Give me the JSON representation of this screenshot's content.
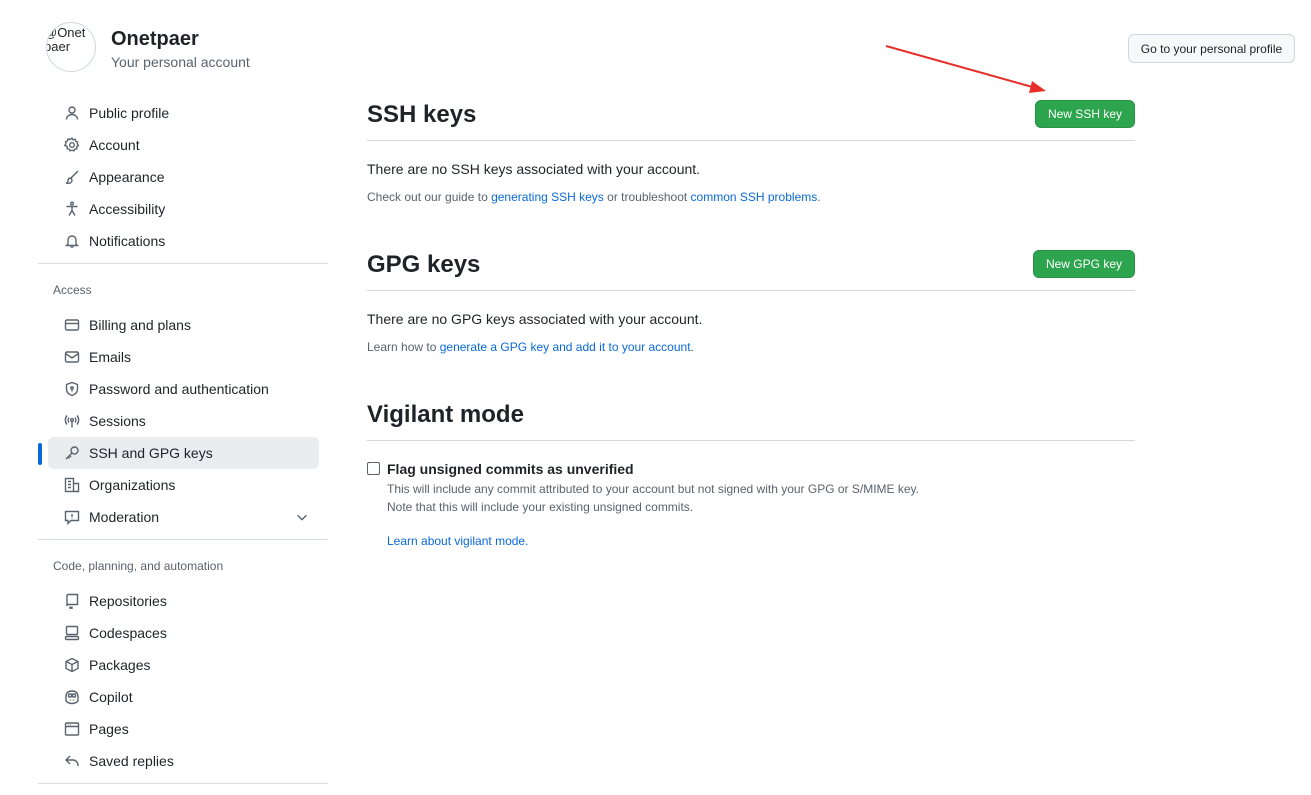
{
  "account": {
    "avatar_alt_line1": "@Onet",
    "avatar_alt_line2": "paer",
    "name": "Onetpaer",
    "subtitle": "Your personal account",
    "go_profile_label": "Go to your personal profile"
  },
  "sidebar": {
    "top_items": [
      {
        "label": "Public profile",
        "icon": "person-icon"
      },
      {
        "label": "Account",
        "icon": "gear-icon"
      },
      {
        "label": "Appearance",
        "icon": "paintbrush-icon"
      },
      {
        "label": "Accessibility",
        "icon": "accessibility-icon"
      },
      {
        "label": "Notifications",
        "icon": "bell-icon"
      }
    ],
    "access_heading": "Access",
    "access_items": [
      {
        "label": "Billing and plans",
        "icon": "credit-card-icon"
      },
      {
        "label": "Emails",
        "icon": "mail-icon"
      },
      {
        "label": "Password and authentication",
        "icon": "shield-lock-icon"
      },
      {
        "label": "Sessions",
        "icon": "broadcast-icon"
      },
      {
        "label": "SSH and GPG keys",
        "icon": "key-icon",
        "active": true
      },
      {
        "label": "Organizations",
        "icon": "organization-icon"
      },
      {
        "label": "Moderation",
        "icon": "report-icon",
        "expandable": true
      }
    ],
    "code_heading": "Code, planning, and automation",
    "code_items": [
      {
        "label": "Repositories",
        "icon": "repo-icon"
      },
      {
        "label": "Codespaces",
        "icon": "codespaces-icon"
      },
      {
        "label": "Packages",
        "icon": "package-icon"
      },
      {
        "label": "Copilot",
        "icon": "copilot-icon"
      },
      {
        "label": "Pages",
        "icon": "browser-icon"
      },
      {
        "label": "Saved replies",
        "icon": "reply-icon"
      }
    ]
  },
  "ssh": {
    "title": "SSH keys",
    "button": "New SSH key",
    "empty_msg": "There are no SSH keys associated with your account.",
    "guide_prefix": "Check out our guide to ",
    "guide_link1": "generating SSH keys",
    "guide_middle": " or troubleshoot ",
    "guide_link2": "common SSH problems",
    "guide_suffix": "."
  },
  "gpg": {
    "title": "GPG keys",
    "button": "New GPG key",
    "empty_msg": "There are no GPG keys associated with your account.",
    "learn_prefix": "Learn how to ",
    "learn_link": "generate a GPG key and add it to your account",
    "learn_suffix": "."
  },
  "vigilant": {
    "title": "Vigilant mode",
    "checkbox_label": "Flag unsigned commits as unverified",
    "checked": false,
    "note_line1": "This will include any commit attributed to your account but not signed with your GPG or S/MIME key.",
    "note_line2": "Note that this will include your existing unsigned commits.",
    "learn_link": "Learn about vigilant mode."
  },
  "colors": {
    "accent": "#0969da",
    "primary_button": "#2da44e",
    "annotation_arrow": "#e8302a"
  }
}
